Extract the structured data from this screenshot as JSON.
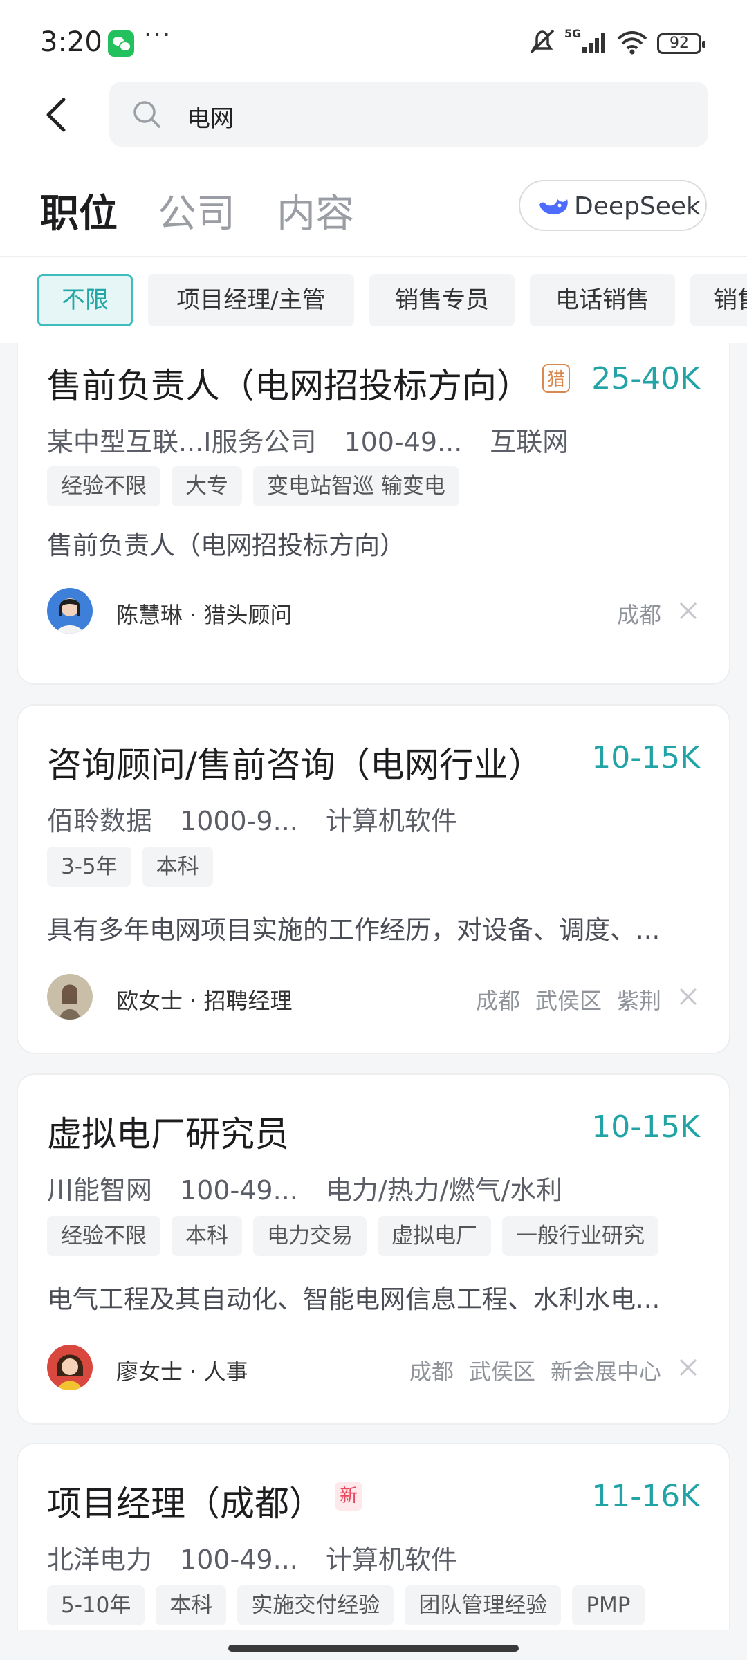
{
  "status": {
    "time": "3:20",
    "dots": "···",
    "network": "5G",
    "battery": "92"
  },
  "search": {
    "query": "电网"
  },
  "tabs": [
    {
      "label": "职位",
      "active": true
    },
    {
      "label": "公司",
      "active": false
    },
    {
      "label": "内容",
      "active": false
    }
  ],
  "deepseek": {
    "label": "DeepSeek",
    "color": "#4d6bfe"
  },
  "filters": [
    {
      "label": "不限",
      "active": true
    },
    {
      "label": "项目经理/主管"
    },
    {
      "label": "销售专员"
    },
    {
      "label": "电话销售"
    },
    {
      "label": "销售"
    }
  ],
  "accent": "#22a3a6",
  "jobs": [
    {
      "title": "售前负责人（电网招投标方向）",
      "badge": "猎",
      "salary": "25-40K",
      "company": "某中型互联...I服务公司",
      "size": "100-49...",
      "industry": "互联网",
      "tags": [
        "经验不限",
        "大专",
        "变电站智巡 输变电"
      ],
      "desc": "售前负责人（电网招投标方向）",
      "recruiter": "陈慧琳 · 猎头顾问",
      "location": [
        "成都"
      ]
    },
    {
      "title": "咨询顾问/售前咨询（电网行业）",
      "salary": "10-15K",
      "company": "佰聆数据",
      "size": "1000-9...",
      "industry": "计算机软件",
      "tags": [
        "3-5年",
        "本科"
      ],
      "desc": "具有多年电网项目实施的工作经历，对设备、调度、...",
      "recruiter": "欧女士 · 招聘经理",
      "location": [
        "成都",
        "武侯区",
        "紫荆"
      ]
    },
    {
      "title": "虚拟电厂研究员",
      "salary": "10-15K",
      "company": "川能智网",
      "size": "100-49...",
      "industry": "电力/热力/燃气/水利",
      "tags": [
        "经验不限",
        "本科",
        "电力交易",
        "虚拟电厂",
        "一般行业研究"
      ],
      "desc": "电气工程及其自动化、智能电网信息工程、水利水电...",
      "recruiter": "廖女士 · 人事",
      "location": [
        "成都",
        "武侯区",
        "新会展中心"
      ]
    },
    {
      "title": "项目经理（成都）",
      "badge": "新",
      "salary": "11-16K",
      "company": "北洋电力",
      "size": "100-49...",
      "industry": "计算机软件",
      "tags": [
        "5-10年",
        "本科",
        "实施交付经验",
        "团队管理经验",
        "PMP"
      ]
    }
  ]
}
